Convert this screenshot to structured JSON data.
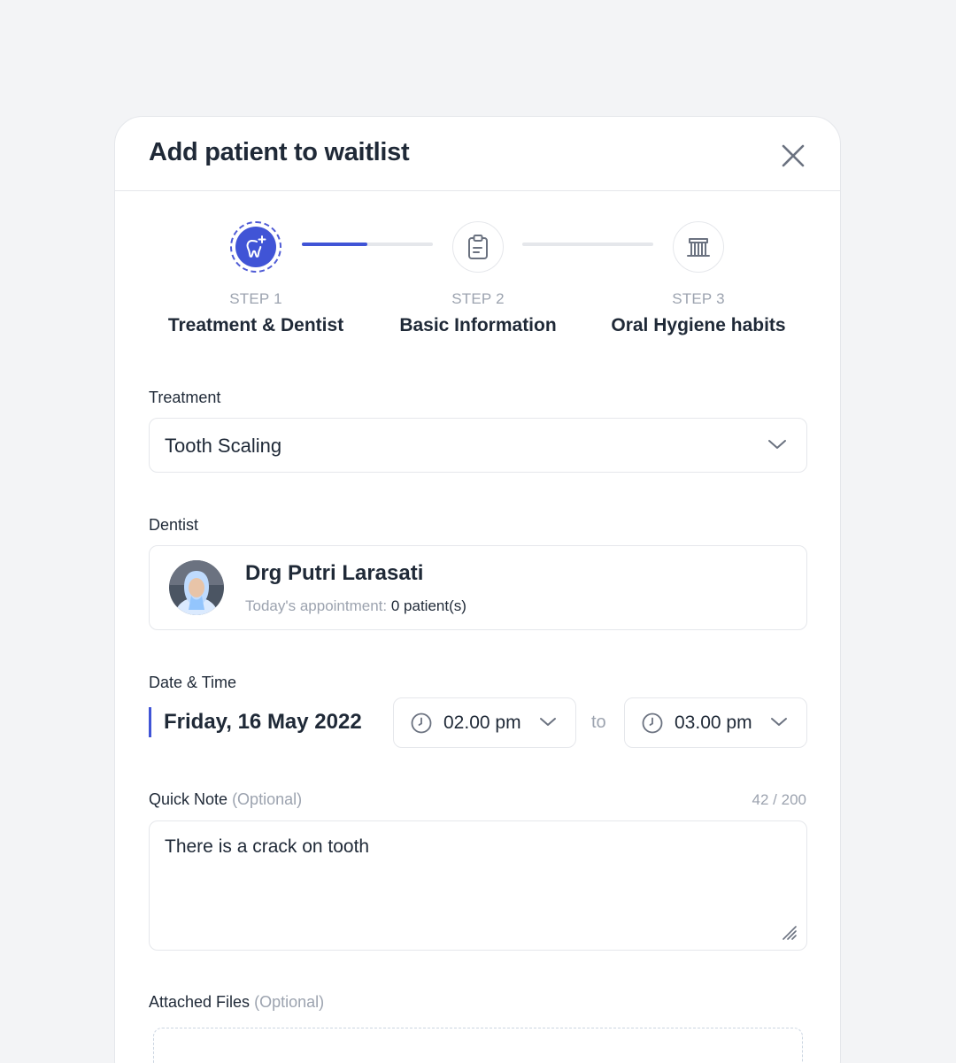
{
  "modal": {
    "title": "Add patient to waitlist"
  },
  "steps": [
    {
      "number": "STEP 1",
      "label": "Treatment & Dentist",
      "icon": "tooth-sparkle-icon",
      "active": true
    },
    {
      "number": "STEP 2",
      "label": "Basic Information",
      "icon": "clipboard-icon",
      "active": false
    },
    {
      "number": "STEP 3",
      "label": "Oral Hygiene habits",
      "icon": "toothbrush-icon",
      "active": false
    }
  ],
  "progress": {
    "step1_to_step2": 0.5,
    "step2_to_step3": 0
  },
  "treatment": {
    "label": "Treatment",
    "value": "Tooth Scaling"
  },
  "dentist": {
    "label": "Dentist",
    "name": "Drg Putri Larasati",
    "appointment_label": "Today's appointment:",
    "appointment_count": "0 patient(s)"
  },
  "datetime": {
    "label": "Date & Time",
    "date": "Friday, 16 May 2022",
    "start": "02.00 pm",
    "to": "to",
    "end": "03.00 pm"
  },
  "note": {
    "label": "Quick Note",
    "optional": "(Optional)",
    "count": "42 / 200",
    "value": "There is a crack on tooth"
  },
  "files": {
    "label": "Attached Files",
    "optional": "(Optional)"
  },
  "colors": {
    "accent": "#4054d6",
    "border": "#e5e7eb",
    "muted": "#9ca3af",
    "text": "#1f2937",
    "background": "#f3f4f6"
  }
}
